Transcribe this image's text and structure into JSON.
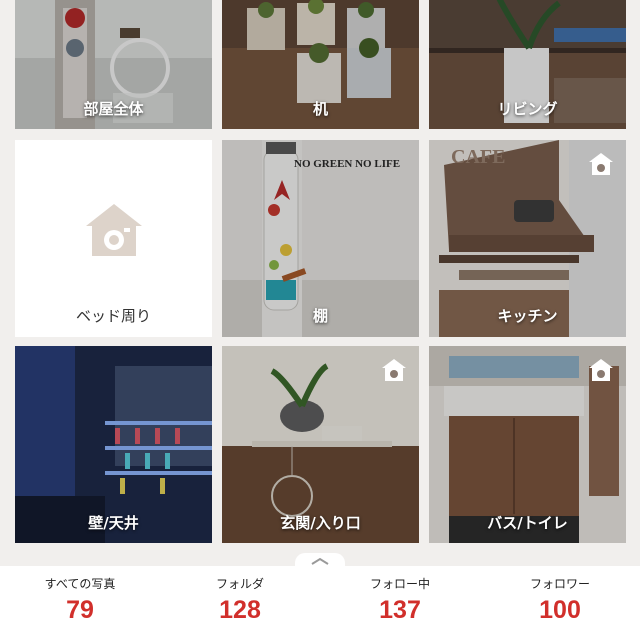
{
  "folders": [
    {
      "label": "部屋全体",
      "has_camera_badge": false
    },
    {
      "label": "机",
      "has_camera_badge": false
    },
    {
      "label": "リビング",
      "has_camera_badge": false
    },
    {
      "label": "ベッド周り",
      "has_camera_badge": false,
      "placeholder_icon": "home-camera-icon"
    },
    {
      "label": "棚",
      "has_camera_badge": false,
      "photo_text": "NO GREEN NO LIFE"
    },
    {
      "label": "キッチン",
      "has_camera_badge": true,
      "photo_text": "CAFE"
    },
    {
      "label": "壁/天井",
      "has_camera_badge": false
    },
    {
      "label": "玄関/入り口",
      "has_camera_badge": true
    },
    {
      "label": "バス/トイレ",
      "has_camera_badge": true
    }
  ],
  "stats": [
    {
      "label": "すべての写真",
      "value": "79"
    },
    {
      "label": "フォルダ",
      "value": "128"
    },
    {
      "label": "フォロー中",
      "value": "137"
    },
    {
      "label": "フォロワー",
      "value": "100"
    }
  ],
  "colors": {
    "accent": "#d12f2b",
    "background": "#f1efed"
  }
}
